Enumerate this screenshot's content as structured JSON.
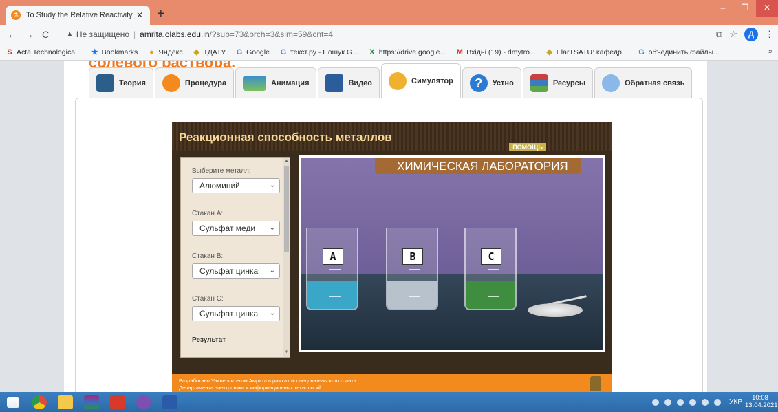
{
  "browser": {
    "tab_title": "To Study the Relative Reactivity o",
    "tab_close": "✕",
    "new_tab": "+",
    "window_controls": [
      "–",
      "❐",
      "✕"
    ],
    "nav": {
      "back": "←",
      "forward": "→",
      "reload": "C"
    },
    "address": {
      "security_icon": "▲",
      "security_label": "Не защищено",
      "separator": "|",
      "host": "amrita.olabs.edu.in",
      "path": "/?sub=73&brch=3&sim=59&cnt=4"
    },
    "right_icons": {
      "translate": "⧉",
      "star": "☆",
      "menu": "⋮"
    },
    "profile_initial": "Д",
    "bookmarks": [
      {
        "icon": "S",
        "color": "#d93025",
        "label": "Acta Technologica..."
      },
      {
        "icon": "★",
        "color": "#1a73e8",
        "label": "Bookmarks"
      },
      {
        "icon": "●",
        "color": "#e8a01a",
        "label": "Яндекс"
      },
      {
        "icon": "◆",
        "color": "#c9a51c",
        "label": "ТДАТУ"
      },
      {
        "icon": "G",
        "color": "#4285f4",
        "label": "Google"
      },
      {
        "icon": "G",
        "color": "#4285f4",
        "label": "текст.ру - Пошук G..."
      },
      {
        "icon": "X",
        "color": "#1e8e3e",
        "label": "https://drive.google..."
      },
      {
        "icon": "M",
        "color": "#d93025",
        "label": "Вхідні (19) - dmytro..."
      },
      {
        "icon": "◆",
        "color": "#c9a51c",
        "label": "ElarTSATU: кафедр..."
      },
      {
        "icon": "G",
        "color": "#4285f4",
        "label": "объединить файлы..."
      }
    ],
    "bookmarks_more": "»"
  },
  "page": {
    "scrolled_heading": "солевого раствора."
  },
  "tabs": [
    {
      "name": "tab-theory",
      "label": "Теория",
      "active": false
    },
    {
      "name": "tab-procedure",
      "label": "Процедура",
      "active": false
    },
    {
      "name": "tab-animation",
      "label": "Анимация",
      "active": false
    },
    {
      "name": "tab-video",
      "label": "Видео",
      "active": false
    },
    {
      "name": "tab-simulator",
      "label": "Симулятор",
      "active": true
    },
    {
      "name": "tab-oral",
      "label": "Устно",
      "active": false
    },
    {
      "name": "tab-resources",
      "label": "Ресурсы",
      "active": false
    },
    {
      "name": "tab-feedback",
      "label": "Обратная связь",
      "active": false
    }
  ],
  "oral_icon_glyph": "?",
  "simulator": {
    "title": "Реакционная способность металлов",
    "help": "ПОМОЩЬ",
    "controls": {
      "metal_label": "Выберите металл:",
      "metal_value": "Алюминий",
      "beaker_a_label": "Стакан A:",
      "beaker_a_value": "Сульфат меди",
      "beaker_b_label": "Стакан B:",
      "beaker_b_value": "Сульфат цинка",
      "beaker_c_label": "Стакан C:",
      "beaker_c_value": "Сульфат цинка",
      "result_link": "Результат",
      "chevron": "⌄",
      "scroll_up": "▲",
      "scroll_down": "▼"
    },
    "lab_title": "ХИМИЧЕСКАЯ ЛАБОРАТОРИЯ",
    "beakers": [
      {
        "label": "A",
        "liquid_color": "#3aa7c8"
      },
      {
        "label": "B",
        "liquid_color": "#b7c2cc"
      },
      {
        "label": "C",
        "liquid_color": "#3f8d3f"
      }
    ],
    "footer_line1": "Разработано Университетом Амрита в рамках исследовательского гранта",
    "footer_line2": "Департамента электроники и информационных технологий"
  },
  "taskbar": {
    "language": "УКР",
    "time": "10:08",
    "date": "13.04.2021"
  },
  "colors": {
    "accent_orange": "#f28a1e",
    "browser_tabbar": "#e88a6c",
    "sim_title": "#f7d89a"
  }
}
